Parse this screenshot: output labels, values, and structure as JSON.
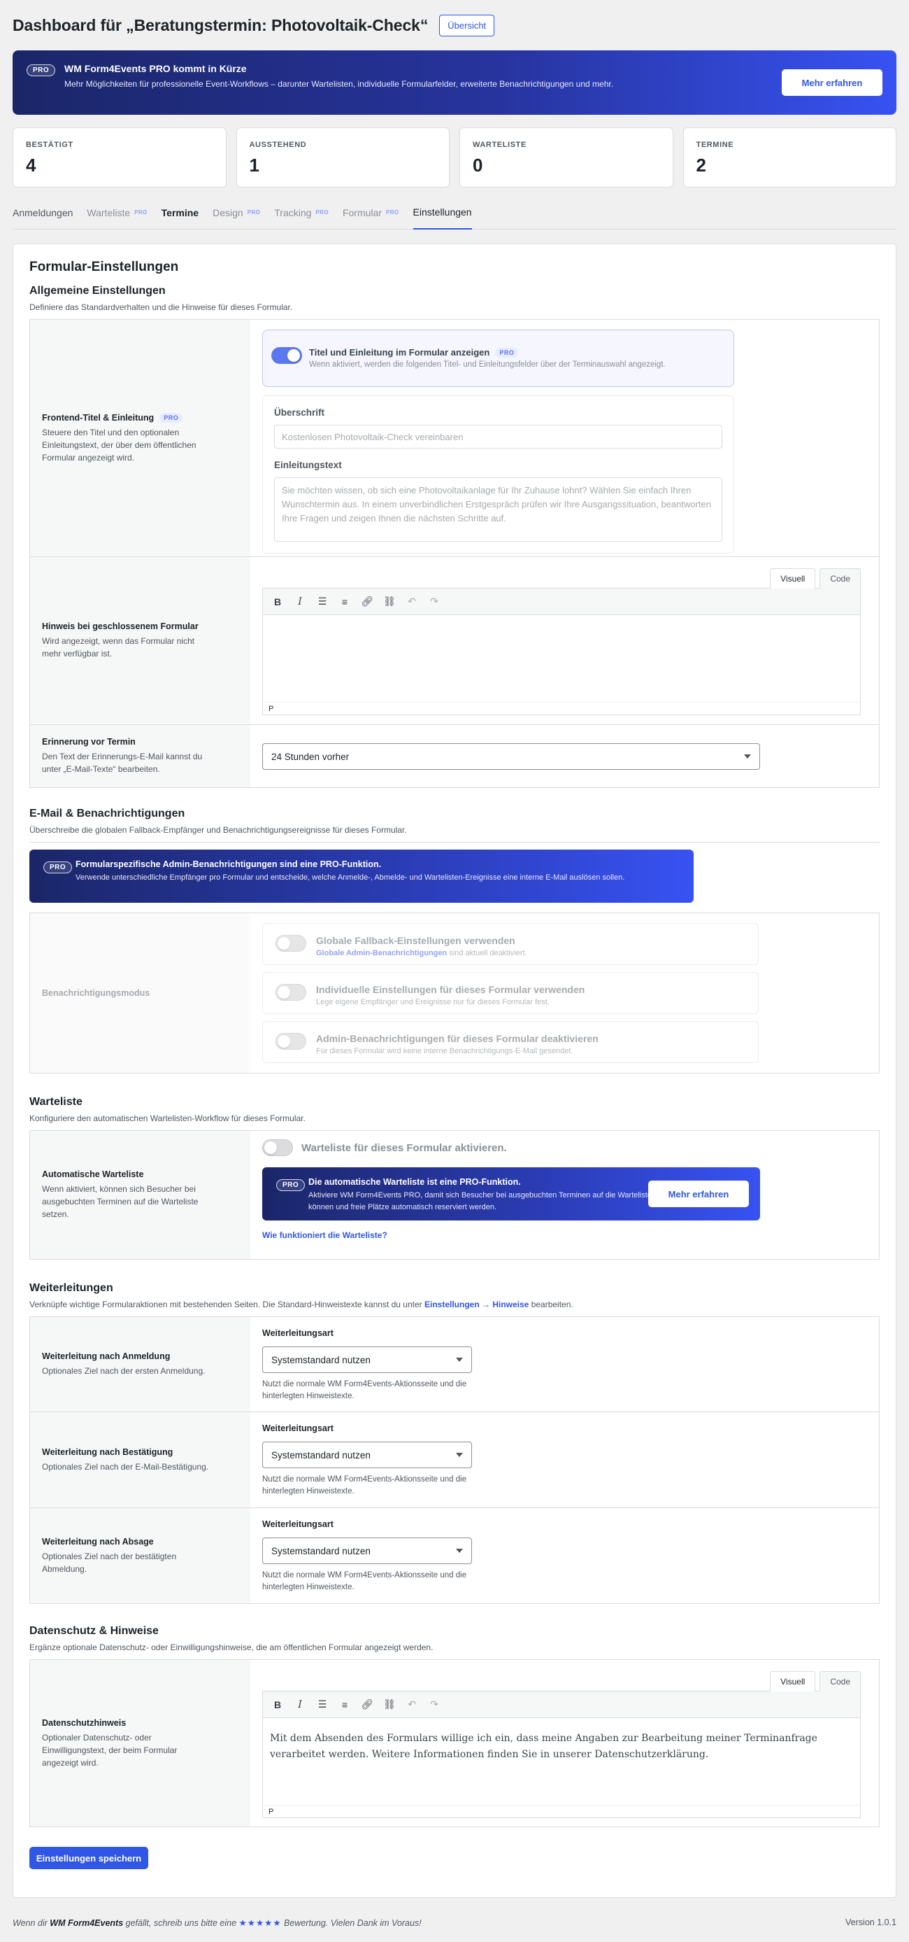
{
  "header": {
    "title": "Dashboard für „Beratungstermin: Photovoltaik-Check“",
    "overview_button": "Übersicht"
  },
  "promo": {
    "badge": "PRO",
    "title": "WM Form4Events PRO kommt in Kürze",
    "text": "Mehr Möglichkeiten für professionelle Event-Workflows – darunter Wartelisten, individuelle Formularfelder, erweiterte Benachrichtigungen und mehr.",
    "button": "Mehr erfahren"
  },
  "stats": [
    {
      "label": "BESTÄTIGT",
      "value": "4"
    },
    {
      "label": "AUSSTEHEND",
      "value": "1"
    },
    {
      "label": "WARTELISTE",
      "value": "0"
    },
    {
      "label": "TERMINE",
      "value": "2"
    }
  ],
  "tabs": [
    {
      "label": "Anmeldungen",
      "pro": ""
    },
    {
      "label": "Warteliste",
      "pro": "PRO"
    },
    {
      "label": "Termine",
      "pro": ""
    },
    {
      "label": "Design",
      "pro": "PRO"
    },
    {
      "label": "Tracking",
      "pro": "PRO"
    },
    {
      "label": "Formular",
      "pro": "PRO"
    },
    {
      "label": "Einstellungen",
      "pro": ""
    }
  ],
  "card_title": "Formular-Einstellungen",
  "general": {
    "title": "Allgemeine Einstellungen",
    "desc": "Definiere das Standardverhalten und die Hinweise für dieses Formular.",
    "frontend": {
      "label": "Frontend-Titel & Einleitung",
      "pro": "PRO",
      "desc": "Steuere den Titel und den optionalen Einleitungstext, der über dem öffentlichen Formular angezeigt wird.",
      "toggle_title": "Titel und Einleitung im Formular anzeigen",
      "toggle_pro": "PRO",
      "toggle_desc": "Wenn aktiviert, werden die folgenden Titel- und Einleitungsfelder über der Terminauswahl angezeigt.",
      "heading_label": "Überschrift",
      "heading_placeholder": "Kostenlosen Photovoltaik-Check vereinbaren",
      "intro_label": "Einleitungstext",
      "intro_placeholder": "Sie möchten wissen, ob sich eine Photovoltaikanlage für Ihr Zuhause lohnt? Wählen Sie einfach Ihren Wunschtermin aus. In einem unverbindlichen Erstgespräch prüfen wir Ihre Ausgangssituation, beantworten Ihre Fragen und zeigen Ihnen die nächsten Schritte auf."
    },
    "closed": {
      "label": "Hinweis bei geschlossenem Formular",
      "desc": "Wird angezeigt, wenn das Formular nicht mehr verfügbar ist.",
      "tab_visual": "Visuell",
      "tab_code": "Code",
      "footer": "P"
    },
    "reminder": {
      "label": "Erinnerung vor Termin",
      "desc": "Den Text der Erinnerungs-E-Mail kannst du unter „E-Mail-Texte“ bearbeiten.",
      "value": "24 Stunden vorher"
    }
  },
  "email": {
    "title": "E-Mail & Benachrichtigungen",
    "desc": "Überschreibe die globalen Fallback-Empfänger und Benachrichtigungsereignisse für dieses Formular.",
    "notice_badge": "PRO",
    "notice_title": "Formularspezifische Admin-Benachrichtigungen sind eine PRO-Funktion.",
    "notice_text": "Verwende unterschiedliche Empfänger pro Formular und entscheide, welche Anmelde-, Abmelde- und Wartelisten-Ereignisse eine interne E-Mail auslösen sollen.",
    "mode_label": "Benachrichtigungsmodus",
    "modes": [
      {
        "title": "Globale Fallback-Einstellungen verwenden",
        "desc_link": "Globale Admin-Benachrichtigungen",
        "desc": " sind aktuell deaktiviert."
      },
      {
        "title": "Individuelle Einstellungen für dieses Formular verwenden",
        "desc_link": "",
        "desc": "Lege eigene Empfänger und Ereignisse nur für dieses Formular fest."
      },
      {
        "title": "Admin-Benachrichtigungen für dieses Formular deaktivieren",
        "desc_link": "",
        "desc": "Für dieses Formular wird keine interne Benachrichtigungs-E-Mail gesendet."
      }
    ]
  },
  "waitlist": {
    "title": "Warteliste",
    "desc": "Konfiguriere den automatischen Wartelisten-Workflow für dieses Formular.",
    "label": "Automatische Warteliste",
    "label_desc": "Wenn aktiviert, können sich Besucher bei ausgebuchten Terminen auf die Warteliste setzen.",
    "toggle": "Warteliste für dieses Formular aktivieren.",
    "notice_badge": "PRO",
    "notice_title": "Die automatische Warteliste ist eine PRO-Funktion.",
    "notice_text": "Aktiviere WM Form4Events PRO, damit sich Besucher bei ausgebuchten Terminen auf die Warteliste setzen können und freie Plätze automatisch reserviert werden.",
    "notice_button": "Mehr erfahren",
    "link": "Wie funktioniert die Warteliste?"
  },
  "redirects": {
    "title": "Weiterleitungen",
    "desc_pre": "Verknüpfe wichtige Formularaktionen mit bestehenden Seiten. Die Standard-Hinweistexte kannst du unter ",
    "desc_link": "Einstellungen → Hinweise",
    "desc_post": " bearbeiten.",
    "rows": [
      {
        "label": "Weiterleitung nach Anmeldung",
        "desc": "Optionales Ziel nach der ersten Anmeldung.",
        "field": "Weiterleitungsart",
        "value": "Systemstandard nutzen",
        "hint": "Nutzt die normale WM Form4Events-Aktionsseite und die hinterlegten Hinweistexte."
      },
      {
        "label": "Weiterleitung nach Bestätigung",
        "desc": "Optionales Ziel nach der E-Mail-Bestätigung.",
        "field": "Weiterleitungsart",
        "value": "Systemstandard nutzen",
        "hint": "Nutzt die normale WM Form4Events-Aktionsseite und die hinterlegten Hinweistexte."
      },
      {
        "label": "Weiterleitung nach Absage",
        "desc": "Optionales Ziel nach der bestätigten Abmeldung.",
        "field": "Weiterleitungsart",
        "value": "Systemstandard nutzen",
        "hint": "Nutzt die normale WM Form4Events-Aktionsseite und die hinterlegten Hinweistexte."
      }
    ]
  },
  "privacy": {
    "title": "Datenschutz & Hinweise",
    "desc": "Ergänze optionale Datenschutz- oder Einwilligungshinweise, die am öffentlichen Formular angezeigt werden.",
    "label": "Datenschutzhinweis",
    "label_desc": "Optionaler Datenschutz- oder Einwilligungstext, der beim Formular angezeigt wird.",
    "tab_visual": "Visuell",
    "tab_code": "Code",
    "content": "Mit dem Absenden des Formulars willige ich ein, dass meine Angaben zur Bearbeitung meiner Terminanfrage verarbeitet werden. Weitere Informationen finden Sie in unserer Datenschutzerklärung.",
    "footer": "P"
  },
  "save_button": "Einstellungen speichern",
  "footer": {
    "pre": "Wenn dir ",
    "brand": "WM Form4Events",
    "mid": " gefällt, schreib uns bitte eine ",
    "stars": "★★★★★",
    "post": " Bewertung. Vielen Dank im Voraus!",
    "version": "Version 1.0.1"
  }
}
